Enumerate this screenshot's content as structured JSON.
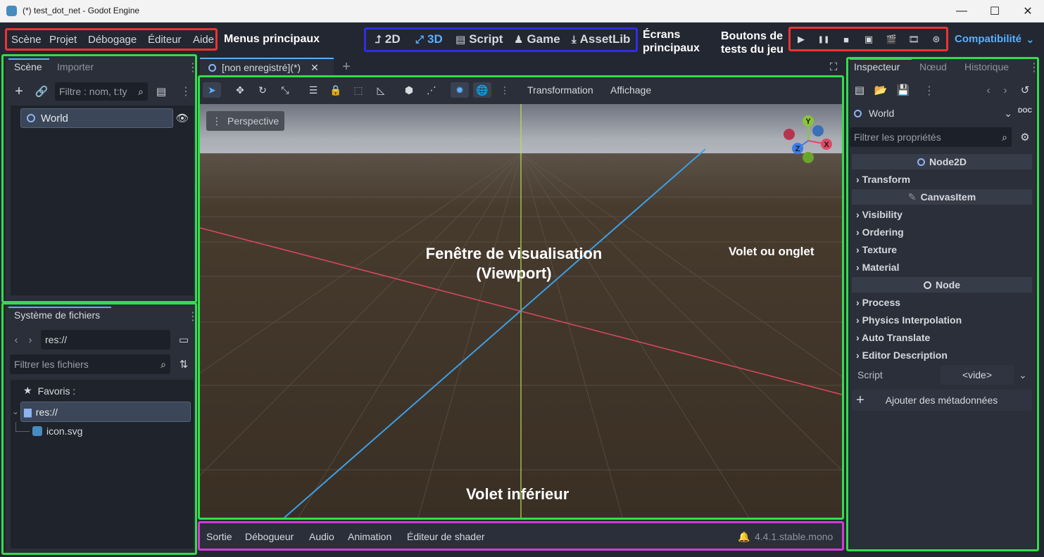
{
  "window": {
    "title": "(*) test_dot_net - Godot Engine",
    "minimize": "—",
    "maximize": "☐",
    "close": "✕"
  },
  "menus": [
    "Scène",
    "Projet",
    "Débogage",
    "Éditeur",
    "Aide"
  ],
  "main_screens": [
    {
      "label": "2D",
      "icon": "2d-icon",
      "glyph": "⮥"
    },
    {
      "label": "3D",
      "icon": "3d-icon",
      "glyph": "⤢"
    },
    {
      "label": "Script",
      "icon": "script-icon",
      "glyph": "▤"
    },
    {
      "label": "Game",
      "icon": "game-icon",
      "glyph": "♟"
    },
    {
      "label": "AssetLib",
      "icon": "assetlib-icon",
      "glyph": "⤓"
    }
  ],
  "play_buttons": [
    {
      "name": "run-project",
      "glyph": "▶"
    },
    {
      "name": "pause",
      "glyph": "❚❚"
    },
    {
      "name": "stop",
      "glyph": "■"
    },
    {
      "name": "remote-deploy",
      "glyph": "▣"
    },
    {
      "name": "run-current-scene",
      "glyph": "🎬"
    },
    {
      "name": "run-specific-scene",
      "glyph": "🎞"
    },
    {
      "name": "movie-maker",
      "glyph": "⊛"
    }
  ],
  "renderer": "Compatibilité",
  "annotations": {
    "menus": "Menus principaux",
    "screens_1": "Écrans",
    "screens_2": "principaux",
    "tests_1": "Boutons de",
    "tests_2": "tests du jeu",
    "viewport_1": "Fenêtre de visualisation",
    "viewport_2": "(Viewport)",
    "dock": "Volet ou onglet",
    "bottom": "Volet inférieur"
  },
  "scene_dock": {
    "tabs": [
      "Scène",
      "Importer"
    ],
    "filter_placeholder": "Filtre : nom, t:ty",
    "root_node": "World"
  },
  "filesystem_dock": {
    "tab": "Système de fichiers",
    "path": "res://",
    "filter_placeholder": "Filtrer les fichiers",
    "favorites": "Favoris :",
    "root": "res://",
    "file": "icon.svg"
  },
  "editor_tabs": {
    "scene_tab": "[non enregistré](*)"
  },
  "viewport_toolbar": {
    "transform_menu": "Transformation",
    "view_menu": "Affichage",
    "perspective": "Perspective"
  },
  "gizmo": {
    "x": "X",
    "y": "Y",
    "z": "Z"
  },
  "inspector": {
    "tabs": [
      "Inspecteur",
      "Nœud",
      "Historique"
    ],
    "node": "World",
    "filter_placeholder": "Filtrer les propriétés",
    "sections": {
      "node2d": "Node2D",
      "canvasitem": "CanvasItem",
      "node": "Node"
    },
    "props_node2d": [
      "Transform"
    ],
    "props_canvasitem": [
      "Visibility",
      "Ordering",
      "Texture",
      "Material"
    ],
    "props_node": [
      "Process",
      "Physics Interpolation",
      "Auto Translate",
      "Editor Description"
    ],
    "script_label": "Script",
    "script_value": "<vide>",
    "add_metadata": "Ajouter des métadonnées",
    "doc": "DOC"
  },
  "bottom_panel": {
    "tabs": [
      "Sortie",
      "Débogueur",
      "Audio",
      "Animation",
      "Éditeur de shader"
    ],
    "version": "4.4.1.stable.mono"
  },
  "colors": {
    "bg": "#232731",
    "panel": "#2a2f3a",
    "accent": "#5ab0ff",
    "axis_x": "#e04864",
    "axis_z": "#3ba0e8",
    "axis_y": "#b8e04a"
  }
}
